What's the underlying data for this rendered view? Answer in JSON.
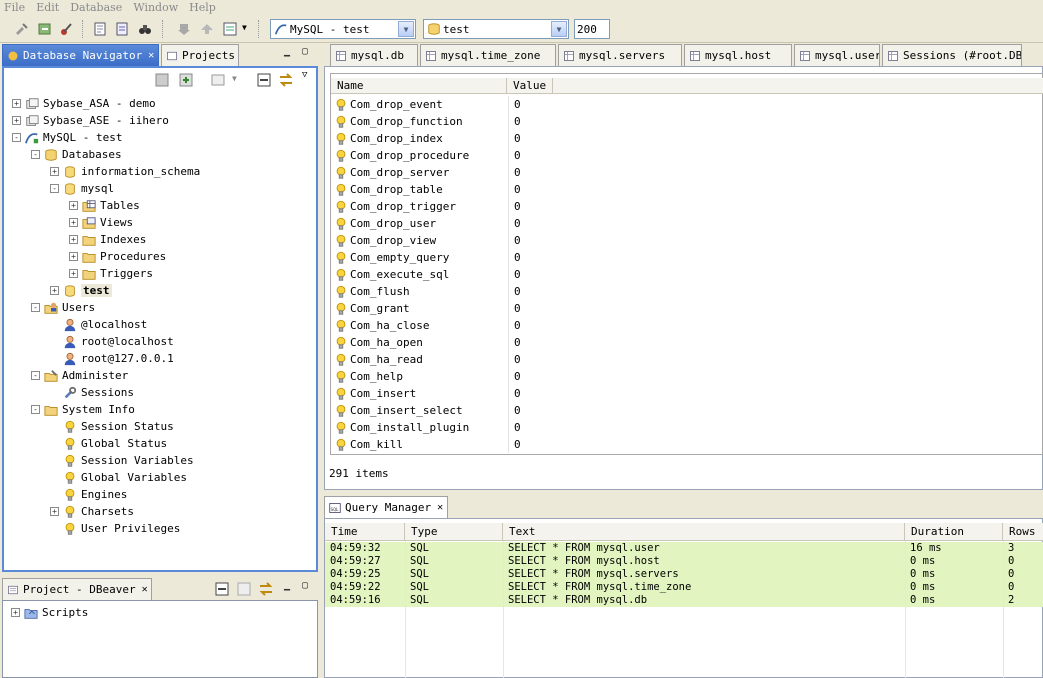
{
  "menu": [
    "File",
    "Edit",
    "Database",
    "Window",
    "Help"
  ],
  "toolbar": {
    "connection": "MySQL - test",
    "database": "test",
    "max_rows": "200"
  },
  "navigator": {
    "tab_label": "Database Navigator",
    "projects_tab": "Projects",
    "tree": [
      {
        "label": "Sybase_ASA - demo",
        "level": 0,
        "exp": "+",
        "icon": "db-connection-icon"
      },
      {
        "label": "Sybase_ASE - iihero",
        "level": 0,
        "exp": "+",
        "icon": "db-connection-icon"
      },
      {
        "label": "MySQL - test",
        "level": 0,
        "exp": "-",
        "icon": "mysql-connection-icon"
      },
      {
        "label": "Databases",
        "level": 1,
        "exp": "-",
        "icon": "folder-db-icon"
      },
      {
        "label": "information_schema",
        "level": 2,
        "exp": "+",
        "icon": "database-icon"
      },
      {
        "label": "mysql",
        "level": 2,
        "exp": "-",
        "icon": "database-icon"
      },
      {
        "label": "Tables",
        "level": 3,
        "exp": "+",
        "icon": "tables-folder-icon"
      },
      {
        "label": "Views",
        "level": 3,
        "exp": "+",
        "icon": "views-folder-icon"
      },
      {
        "label": "Indexes",
        "level": 3,
        "exp": "+",
        "icon": "folder-icon"
      },
      {
        "label": "Procedures",
        "level": 3,
        "exp": "+",
        "icon": "folder-icon"
      },
      {
        "label": "Triggers",
        "level": 3,
        "exp": "+",
        "icon": "folder-icon"
      },
      {
        "label": "test",
        "level": 2,
        "exp": "+",
        "icon": "database-icon",
        "bold": true
      },
      {
        "label": "Users",
        "level": 1,
        "exp": "-",
        "icon": "users-folder-icon"
      },
      {
        "label": "@localhost",
        "level": 2,
        "exp": "",
        "icon": "user-icon"
      },
      {
        "label": "root@localhost",
        "level": 2,
        "exp": "",
        "icon": "user-icon"
      },
      {
        "label": "root@127.0.0.1",
        "level": 2,
        "exp": "",
        "icon": "user-icon"
      },
      {
        "label": "Administer",
        "level": 1,
        "exp": "-",
        "icon": "admin-folder-icon"
      },
      {
        "label": "Sessions",
        "level": 2,
        "exp": "",
        "icon": "wrench-icon"
      },
      {
        "label": "System Info",
        "level": 1,
        "exp": "-",
        "icon": "folder-icon"
      },
      {
        "label": "Session Status",
        "level": 2,
        "exp": "",
        "icon": "bulb-icon"
      },
      {
        "label": "Global Status",
        "level": 2,
        "exp": "",
        "icon": "bulb-icon"
      },
      {
        "label": "Session Variables",
        "level": 2,
        "exp": "",
        "icon": "bulb-icon"
      },
      {
        "label": "Global Variables",
        "level": 2,
        "exp": "",
        "icon": "bulb-icon"
      },
      {
        "label": "Engines",
        "level": 2,
        "exp": "",
        "icon": "bulb-icon"
      },
      {
        "label": "Charsets",
        "level": 2,
        "exp": "+",
        "icon": "bulb-icon"
      },
      {
        "label": "User Privileges",
        "level": 2,
        "exp": "",
        "icon": "bulb-icon"
      }
    ]
  },
  "project": {
    "tab_label": "Project - DBeaver",
    "tree": [
      {
        "label": "Scripts",
        "exp": "+",
        "icon": "scripts-folder-icon"
      }
    ]
  },
  "editor_tabs": [
    "mysql.db",
    "mysql.time_zone",
    "mysql.servers",
    "mysql.host",
    "mysql.user",
    "Sessions (#root.DBe"
  ],
  "status_grid": {
    "columns": [
      "Name",
      "Value"
    ],
    "rows": [
      [
        "Com_drop_event",
        "0"
      ],
      [
        "Com_drop_function",
        "0"
      ],
      [
        "Com_drop_index",
        "0"
      ],
      [
        "Com_drop_procedure",
        "0"
      ],
      [
        "Com_drop_server",
        "0"
      ],
      [
        "Com_drop_table",
        "0"
      ],
      [
        "Com_drop_trigger",
        "0"
      ],
      [
        "Com_drop_user",
        "0"
      ],
      [
        "Com_drop_view",
        "0"
      ],
      [
        "Com_empty_query",
        "0"
      ],
      [
        "Com_execute_sql",
        "0"
      ],
      [
        "Com_flush",
        "0"
      ],
      [
        "Com_grant",
        "0"
      ],
      [
        "Com_ha_close",
        "0"
      ],
      [
        "Com_ha_open",
        "0"
      ],
      [
        "Com_ha_read",
        "0"
      ],
      [
        "Com_help",
        "0"
      ],
      [
        "Com_insert",
        "0"
      ],
      [
        "Com_insert_select",
        "0"
      ],
      [
        "Com_install_plugin",
        "0"
      ],
      [
        "Com_kill",
        "0"
      ]
    ],
    "footer": "291 items"
  },
  "query_manager": {
    "tab_label": "Query Manager",
    "columns": [
      "Time",
      "Type",
      "Text",
      "Duration",
      "Rows"
    ],
    "rows": [
      [
        "04:59:32",
        "SQL",
        "SELECT * FROM mysql.user",
        "16 ms",
        "3"
      ],
      [
        "04:59:27",
        "SQL",
        "SELECT * FROM mysql.host",
        "0 ms",
        "0"
      ],
      [
        "04:59:25",
        "SQL",
        "SELECT * FROM mysql.servers",
        "0 ms",
        "0"
      ],
      [
        "04:59:22",
        "SQL",
        "SELECT * FROM mysql.time_zone",
        "0 ms",
        "0"
      ],
      [
        "04:59:16",
        "SQL",
        "SELECT * FROM mysql.db",
        "0 ms",
        "2"
      ]
    ],
    "row_color": "#e2f5c0"
  }
}
